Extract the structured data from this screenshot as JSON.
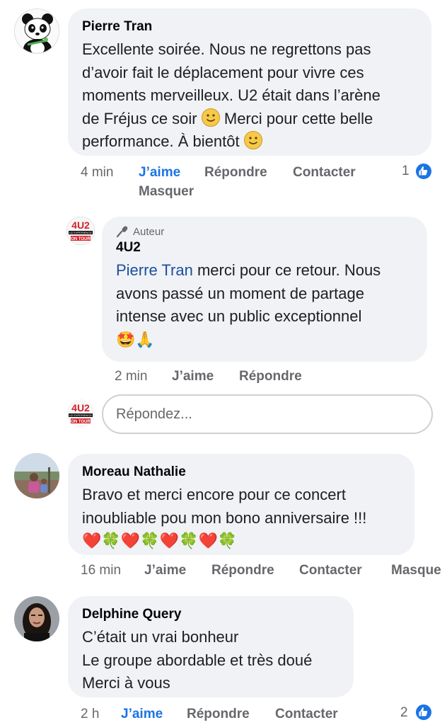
{
  "comments": [
    {
      "author": "Pierre Tran",
      "lines": [
        "Excellente soirée. Nous ne regrettons pas",
        "d’avoir fait le déplacement pour vivre ces",
        "moments merveilleux. U2 était dans l’arène",
        "de Fréjus ce soir",
        "Merci pour cette belle",
        "performance. À bientôt"
      ],
      "time": "4 min",
      "like": "J’aime",
      "reply": "Répondre",
      "contact": "Contacter",
      "hide": "Masquer",
      "like_count": "1"
    },
    {
      "author": "Moreau Nathalie",
      "lines": [
        "Bravo et merci encore pour ce concert",
        "inoubliable pou mon bono anniversaire !!!"
      ],
      "emojis": [
        "❤️",
        "🍀",
        "❤️",
        "🍀",
        "❤️",
        "🍀",
        "❤️",
        "🍀"
      ],
      "time": "16 min",
      "like": "J’aime",
      "reply": "Répondre",
      "contact": "Contacter",
      "hide": "Masque"
    },
    {
      "author": "Delphine Query",
      "lines": [
        "C’était un vrai bonheur",
        "Le groupe abordable et très doué",
        "Merci à vous"
      ],
      "time": "2 h",
      "like": "J’aime",
      "reply": "Répondre",
      "contact": "Contacter",
      "like_count": "2"
    }
  ],
  "reply": {
    "badge": "Auteur",
    "author": "4U2",
    "mention": "Pierre Tran",
    "lines": [
      "merci pour ce retour. Nous",
      "avons passé un moment de partage",
      "intense avec un public exceptionnel"
    ],
    "emojis": [
      "🤩",
      "🙏"
    ],
    "time": "2 min",
    "like": "J’aime",
    "reply": "Répondre"
  },
  "avatar_text": {
    "logo": "4U2",
    "tagline": "U2 EXPERIENCE",
    "tour": "ON TOUR"
  },
  "reply_input": {
    "placeholder": "Répondez..."
  },
  "colors": {
    "bubble": "#f0f2f5",
    "link_blue": "#1b74e4",
    "mention_blue": "#1b4f9e",
    "muted": "#65676b",
    "brand_red": "#d3202a"
  }
}
